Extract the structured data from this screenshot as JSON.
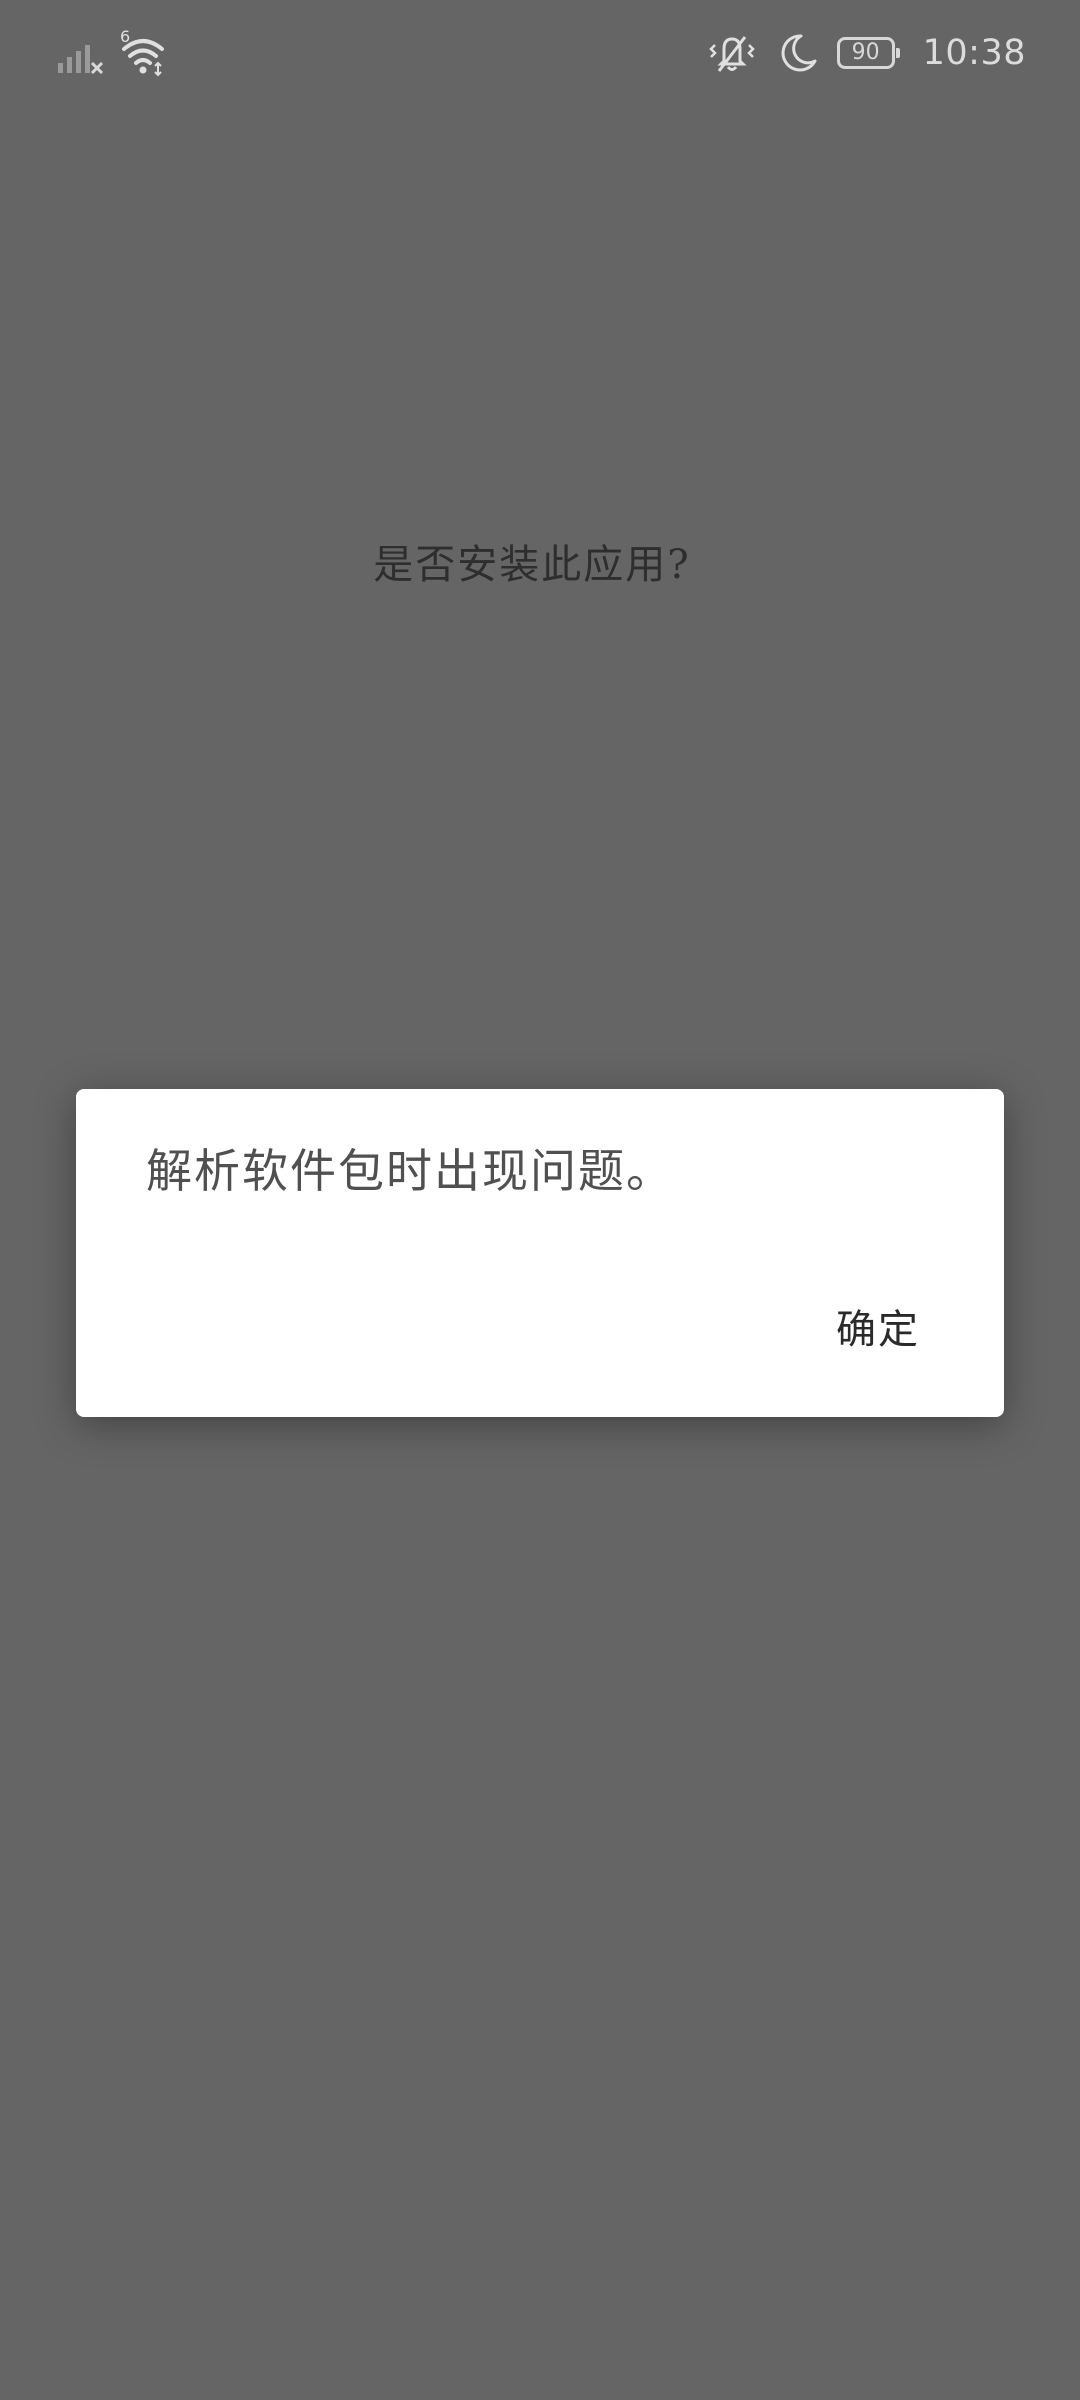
{
  "status_bar": {
    "signal_icon": "cellular-signal-no-service-icon",
    "wifi_icon": "wifi-icon",
    "wifi_badge": "6",
    "vibrate_icon": "vibrate-mode-icon",
    "dnd_icon": "moon-icon",
    "battery_level": "90",
    "time": "10:38"
  },
  "installer": {
    "question": "是否安装此应用?"
  },
  "dialog": {
    "message": "解析软件包时出现问题。",
    "ok_label": "确定"
  },
  "colors": {
    "scrim_background": "#656565",
    "dialog_background": "#ffffff"
  }
}
